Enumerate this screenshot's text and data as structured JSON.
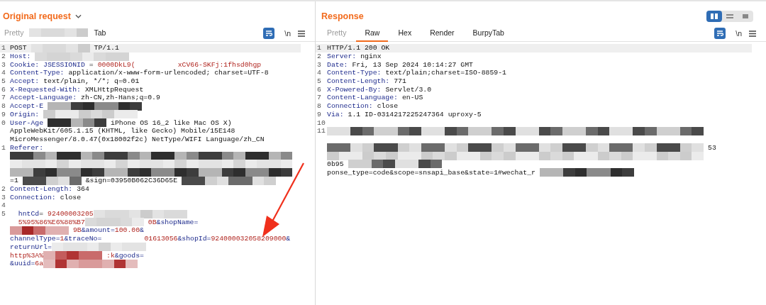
{
  "panels": [
    {
      "title": "Original request",
      "dropdown": true,
      "newline_toggle": "\\n",
      "tabs": [
        {
          "kind": "tab",
          "label": "Pretty",
          "selected": false,
          "disabled": true
        },
        {
          "kind": "haze"
        },
        {
          "kind": "tab",
          "label": "Tab",
          "selected": false,
          "disabled": false
        }
      ],
      "lines": [
        {
          "num": "1",
          "current": true,
          "parts": [
            {
              "kind": "plain",
              "text": "POST"
            },
            {
              "kind": "haze"
            },
            {
              "kind": "plain",
              "text": "TP/1.1"
            }
          ]
        },
        {
          "num": "2",
          "current": false,
          "parts": [
            {
              "kind": "name",
              "text": "Host:"
            },
            {
              "kind": "haze"
            }
          ]
        },
        {
          "num": "3",
          "current": false,
          "parts": [
            {
              "kind": "name",
              "text": "Cookie: JSESSIONID"
            },
            {
              "kind": "plain",
              "text": "="
            },
            {
              "kind": "param",
              "text": "0000DkL9("
            },
            {
              "kind": "gap"
            },
            {
              "kind": "param",
              "text": "xCV66-SKFj:1fhsd0hgp"
            }
          ]
        },
        {
          "num": "4",
          "current": false,
          "parts": [
            {
              "kind": "name",
              "text": "Content-Type:"
            },
            {
              "kind": "plain",
              "text": "application/x-www-form-urlencoded; charset=UTF-8"
            }
          ]
        },
        {
          "num": "5",
          "current": false,
          "parts": [
            {
              "kind": "name",
              "text": "Accept:"
            },
            {
              "kind": "plain",
              "text": "text/plain, */*; q=0.01"
            }
          ]
        },
        {
          "num": "6",
          "current": false,
          "parts": [
            {
              "kind": "name",
              "text": "X-Requested-With:"
            },
            {
              "kind": "plain",
              "text": "XMLHttpRequest"
            }
          ]
        },
        {
          "num": "7",
          "current": false,
          "parts": [
            {
              "kind": "name",
              "text": "Accept-Language:"
            },
            {
              "kind": "plain",
              "text": "zh-CN,zh-Hans;q=0.9"
            }
          ]
        },
        {
          "num": "8",
          "current": false,
          "parts": [
            {
              "kind": "name",
              "text": "Accept-E"
            },
            {
              "kind": "mosaic"
            }
          ]
        },
        {
          "num": "9",
          "current": false,
          "parts": [
            {
              "kind": "name",
              "text": "Origin:"
            },
            {
              "kind": "haze"
            }
          ]
        },
        {
          "num": "0",
          "current": false,
          "parts": [
            {
              "kind": "name",
              "text": "User-Age"
            },
            {
              "kind": "mosaic"
            },
            {
              "kind": "plain",
              "text": "iPhone OS 16_2 like Mac OS X)"
            }
          ]
        },
        {
          "current": false,
          "parts": [
            {
              "kind": "plain",
              "text": "AppleWebKit/605.1.15 (KHTML, like Gecko) Mobile/15E148"
            }
          ]
        },
        {
          "current": false,
          "parts": [
            {
              "kind": "plain",
              "text": "MicroMessenger/8.0.47(0x18002f2c) NetType/WIFI Language/zh_CN"
            }
          ]
        },
        {
          "num": "1",
          "current": false,
          "parts": [
            {
              "kind": "name",
              "text": "Referer:"
            }
          ]
        },
        {
          "current": false,
          "parts": [
            {
              "kind": "mosaic"
            }
          ]
        },
        {
          "current": false,
          "parts": [
            {
              "kind": "haze"
            }
          ]
        },
        {
          "current": false,
          "parts": [
            {
              "kind": "mosaic"
            }
          ]
        },
        {
          "current": false,
          "parts": [
            {
              "kind": "plain",
              "text": "=1"
            },
            {
              "kind": "mosaic"
            },
            {
              "kind": "plain",
              "text": "&sign=03950B062C36D65E"
            },
            {
              "kind": "mosaic"
            }
          ]
        },
        {
          "num": "2",
          "current": false,
          "parts": [
            {
              "kind": "name",
              "text": "Content-Length:"
            },
            {
              "kind": "plain",
              "text": "364"
            }
          ]
        },
        {
          "num": "3",
          "current": false,
          "parts": [
            {
              "kind": "name",
              "text": "Connection:"
            },
            {
              "kind": "plain",
              "text": "close"
            }
          ]
        },
        {
          "num": "4",
          "current": false
        },
        {
          "num": "5",
          "current": false,
          "parts": [
            {
              "kind": "pname",
              "text": "  hntCd"
            },
            {
              "kind": "plain",
              "text": "="
            },
            {
              "kind": "param",
              "text": "92400003205"
            },
            {
              "kind": "haze"
            }
          ]
        },
        {
          "current": false,
          "parts": [
            {
              "kind": "param",
              "text": "  5%95%86%E6%88%B7"
            },
            {
              "kind": "haze"
            },
            {
              "kind": "param",
              "text": "0B"
            },
            {
              "kind": "pname",
              "text": "&shopName="
            }
          ]
        },
        {
          "current": false,
          "parts": [
            {
              "kind": "redmosaic"
            },
            {
              "kind": "param",
              "text": "9B"
            },
            {
              "kind": "pname",
              "text": "&amount="
            },
            {
              "kind": "param",
              "text": "100.00"
            },
            {
              "kind": "pname",
              "text": "&"
            }
          ]
        },
        {
          "current": false,
          "parts": [
            {
              "kind": "pname",
              "text": "channelType="
            },
            {
              "kind": "param",
              "text": "1"
            },
            {
              "kind": "pname",
              "text": "&traceNo="
            },
            {
              "kind": "gap"
            },
            {
              "kind": "param",
              "text": "01613056"
            },
            {
              "kind": "pname",
              "text": "&shopId="
            },
            {
              "kind": "param",
              "text": "924000032058209000"
            },
            {
              "kind": "pname",
              "text": "&"
            }
          ]
        },
        {
          "current": false,
          "parts": [
            {
              "kind": "pname",
              "text": "returnUrl="
            },
            {
              "kind": "haze"
            }
          ]
        },
        {
          "current": false,
          "parts": [
            {
              "kind": "param",
              "text": "http%3A%"
            },
            {
              "kind": "redmosaic"
            },
            {
              "kind": "param",
              "text": ":k"
            },
            {
              "kind": "pname",
              "text": "&goods="
            }
          ]
        },
        {
          "current": false,
          "parts": [
            {
              "kind": "pname",
              "text": "&uuid="
            },
            {
              "kind": "param",
              "text": "6a"
            },
            {
              "kind": "redmosaic"
            }
          ]
        }
      ]
    },
    {
      "title": "Response",
      "dropdown": false,
      "newline_toggle": "\\n",
      "tabs": [
        {
          "kind": "tab",
          "label": "Pretty",
          "selected": false,
          "disabled": true
        },
        {
          "kind": "tab",
          "label": "Raw",
          "selected": true,
          "disabled": false
        },
        {
          "kind": "tab",
          "label": "Hex",
          "selected": false,
          "disabled": false
        },
        {
          "kind": "tab",
          "label": "Render",
          "selected": false,
          "disabled": false
        },
        {
          "kind": "tab",
          "label": "BurpyTab",
          "selected": false,
          "disabled": false
        }
      ],
      "lines": [
        {
          "num": "1",
          "current": true,
          "parts": [
            {
              "kind": "plain",
              "text": "HTTP/1.1 200 OK"
            }
          ]
        },
        {
          "num": "2",
          "current": false,
          "parts": [
            {
              "kind": "name",
              "text": "Server:"
            },
            {
              "kind": "plain",
              "text": "nginx"
            }
          ]
        },
        {
          "num": "3",
          "current": false,
          "parts": [
            {
              "kind": "name",
              "text": "Date:"
            },
            {
              "kind": "plain",
              "text": "Fri, 13 Sep 2024 10:14:27 GMT"
            }
          ]
        },
        {
          "num": "4",
          "current": false,
          "parts": [
            {
              "kind": "name",
              "text": "Content-Type:"
            },
            {
              "kind": "plain",
              "text": "text/plain;charset=ISO-8859-1"
            }
          ]
        },
        {
          "num": "5",
          "current": false,
          "parts": [
            {
              "kind": "name",
              "text": "Content-Length:"
            },
            {
              "kind": "plain",
              "text": "771"
            }
          ]
        },
        {
          "num": "6",
          "current": false,
          "parts": [
            {
              "kind": "name",
              "text": "X-Powered-By:"
            },
            {
              "kind": "plain",
              "text": "Servlet/3.0"
            }
          ]
        },
        {
          "num": "7",
          "current": false,
          "parts": [
            {
              "kind": "name",
              "text": "Content-Language:"
            },
            {
              "kind": "plain",
              "text": "en-US"
            }
          ]
        },
        {
          "num": "8",
          "current": false,
          "parts": [
            {
              "kind": "name",
              "text": "Connection:"
            },
            {
              "kind": "plain",
              "text": "close"
            }
          ]
        },
        {
          "num": "9",
          "current": false,
          "parts": [
            {
              "kind": "name",
              "text": "Via:"
            },
            {
              "kind": "plain",
              "text": "1.1 ID-0314217225247364 uproxy-5"
            }
          ]
        },
        {
          "num": "10",
          "current": false
        },
        {
          "num": "11",
          "current": false,
          "parts": [
            {
              "kind": "mosaic"
            }
          ]
        },
        {
          "current": false
        },
        {
          "current": false,
          "parts": [
            {
              "kind": "mosaic"
            },
            {
              "kind": "plain",
              "text": "53"
            }
          ]
        },
        {
          "current": false,
          "parts": [
            {
              "kind": "haze"
            }
          ]
        },
        {
          "current": false,
          "parts": [
            {
              "kind": "plain",
              "text": "0b95"
            },
            {
              "kind": "mosaic"
            }
          ]
        },
        {
          "current": false,
          "parts": [
            {
              "kind": "plain",
              "text": "ponse_type=code&scope=snsapi_base&state=1#wechat_r"
            },
            {
              "kind": "mosaic"
            }
          ]
        }
      ]
    }
  ],
  "layout_toggle": [
    {
      "selected": true
    },
    {
      "selected": false
    },
    {
      "selected": false
    }
  ]
}
